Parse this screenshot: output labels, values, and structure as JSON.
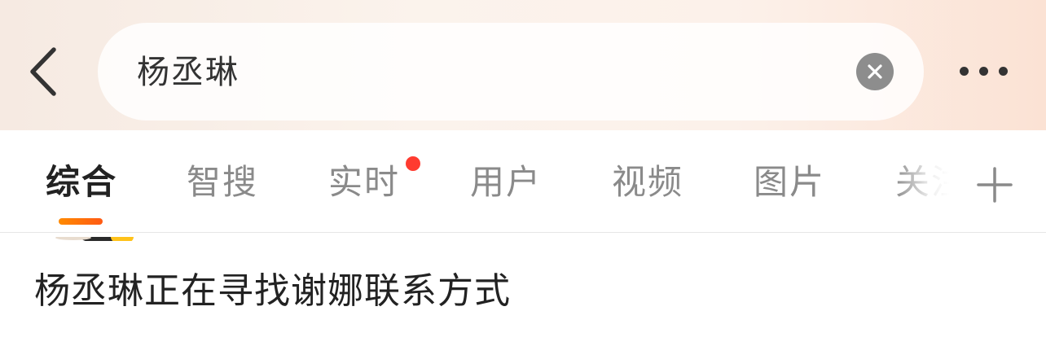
{
  "header": {
    "back_icon": "chevron-left-icon",
    "search": {
      "query": "杨丞琳",
      "clear_icon": "close-circle-icon"
    },
    "more_icon": "more-horizontal-icon"
  },
  "tabs": {
    "items": [
      {
        "label": "综合",
        "active": true
      },
      {
        "label": "智搜",
        "active": false
      },
      {
        "label": "实时",
        "active": false,
        "has_red_dot": true
      },
      {
        "label": "用户",
        "active": false
      },
      {
        "label": "视频",
        "active": false
      },
      {
        "label": "图片",
        "active": false
      },
      {
        "label": "关注",
        "active": false
      }
    ],
    "add_icon": "plus-icon",
    "indicator_color": "#ff7a0a",
    "red_dot_color": "#ff3b30"
  },
  "content": {
    "post_title": "杨丞琳正在寻找谢娜联系方式"
  }
}
